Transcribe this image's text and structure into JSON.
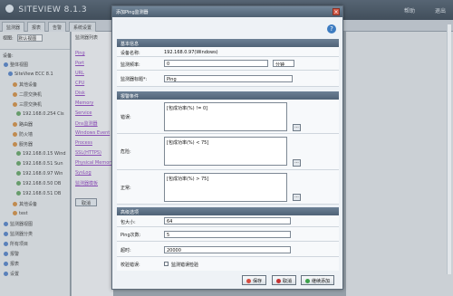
{
  "app": {
    "title": "SITEVIEW 8.1.3"
  },
  "header": {
    "help": "帮助",
    "logout": "退出"
  },
  "tabs": [
    "监测器",
    "报表",
    "告警",
    "系统设置"
  ],
  "left": {
    "view_label": "视图:",
    "view_value": "默认视图",
    "device_label": "设备:",
    "tree": [
      "整体视图",
      "SiteView ECC 8.1",
      "其他设备",
      "二层交换机",
      "三层交换机",
      "192.168.0.254 Cis",
      "路由器",
      "防火墙",
      "服务器",
      "192.168.0.15 Wind",
      "192.168.0.51 Sun",
      "192.168.0.97 Win",
      "192.168.0.50 DB",
      "192.168.0.51 DB",
      "其他设备",
      "test",
      "监测器视图",
      "监测器分类",
      "所有项目",
      "报警",
      "报表",
      "设置"
    ]
  },
  "middle": {
    "header": "监测器列表",
    "links": [
      "Ping",
      "Port",
      "URL",
      "CPU",
      "Disk",
      "Memory",
      "Service",
      "Dns监测器",
      "Windows Event",
      "Process",
      "SSL(HTTPS)",
      "Physical Memory",
      "SysLog",
      "监测器模板"
    ],
    "button": "取消"
  },
  "dialog": {
    "title": "添加Ping监测器",
    "close_glyph": "×",
    "help_glyph": "?",
    "sections": {
      "basic": "基本信息",
      "alert": "报警条件",
      "advanced": "高级选项"
    },
    "basic": {
      "device_label": "设备名称:",
      "device_value": "192.168.0.97(Windows)",
      "freq_label": "监测频率:",
      "freq_value": "0",
      "freq_unit": "分钟",
      "title_label": "监测器标题*:",
      "title_value": "Ping"
    },
    "alert": {
      "error_label": "错误:",
      "error_value": "[包成功率(%) != 0]",
      "warning_label": "危险:",
      "warning_value": "[包成功率(%) < 75]",
      "normal_label": "正常:",
      "normal_value": "[包成功率(%) > 75]",
      "dots": "..."
    },
    "advanced": {
      "packet_size_label": "包大小:",
      "packet_size_value": "64",
      "ping_count_label": "Ping次数:",
      "ping_count_value": "5",
      "timeout_label": "超时:",
      "timeout_value": "20000",
      "verify_label": "校验错误:",
      "verify_text": "监测错误检验"
    },
    "buttons": {
      "save": "保存",
      "cancel": "取消",
      "save_add": "继续添加"
    }
  }
}
